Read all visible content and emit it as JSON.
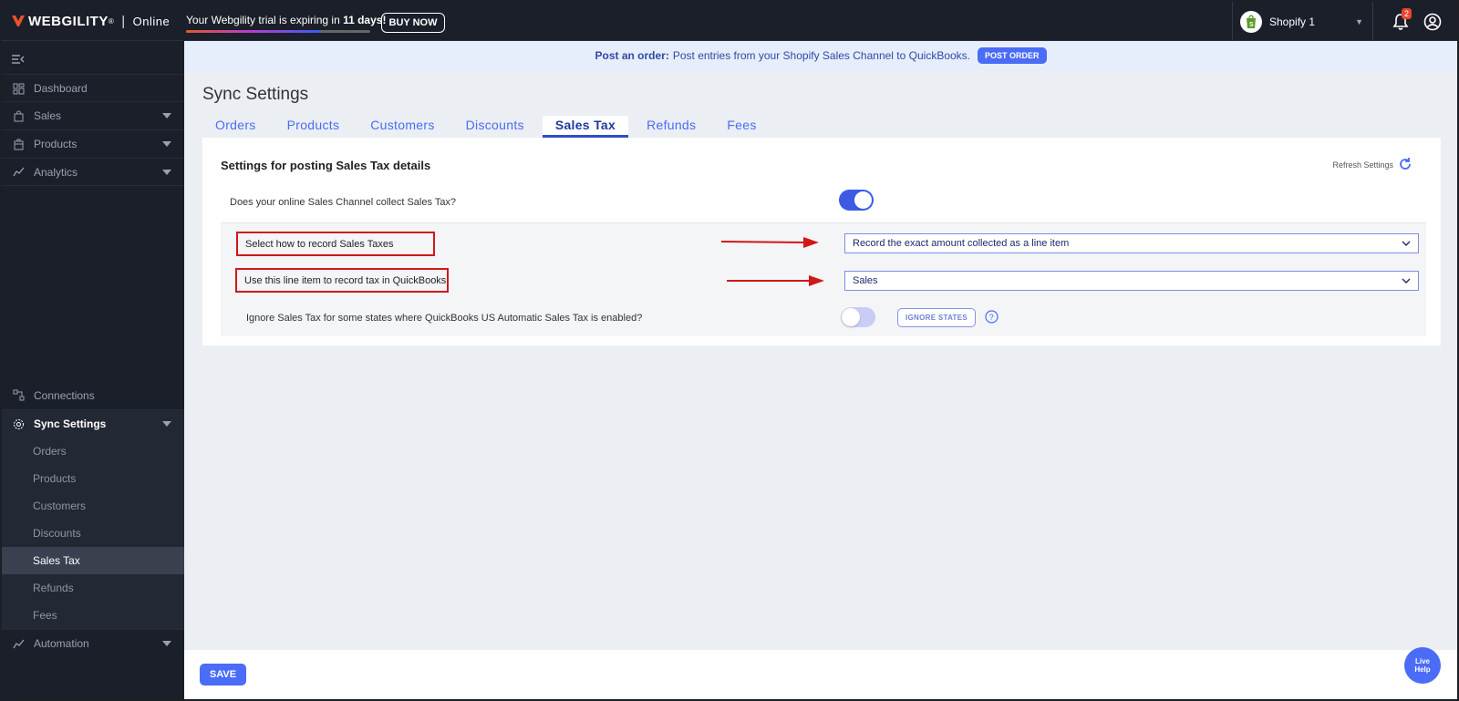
{
  "topbar": {
    "brand": "WEBGILITY",
    "brand_sup": "®",
    "separator": "|",
    "mode": "Online",
    "trial_prefix": "Your Webgility trial is expiring in ",
    "trial_days": "11 days!",
    "trial_progress": 0.73,
    "buy_now": "BUY NOW",
    "store_name": "Shopify 1",
    "notification_count": "2",
    "icons": {
      "bell": "bell-icon",
      "user": "user-circle-icon",
      "store": "shopify-icon"
    }
  },
  "sidebar": {
    "items": [
      {
        "label": "Dashboard",
        "icon": "dashboard-icon",
        "has_caret": false
      },
      {
        "label": "Sales",
        "icon": "bag-icon",
        "has_caret": true
      },
      {
        "label": "Products",
        "icon": "box-icon",
        "has_caret": true
      },
      {
        "label": "Analytics",
        "icon": "chart-icon",
        "has_caret": true
      }
    ],
    "connections": "Connections",
    "sync_settings": "Sync Settings",
    "sync_sub": [
      "Orders",
      "Products",
      "Customers",
      "Discounts",
      "Sales Tax",
      "Refunds",
      "Fees"
    ],
    "selected_sub": "Sales Tax",
    "automation": "Automation"
  },
  "banner": {
    "lead": "Post an order:",
    "text": "Post entries from your Shopify Sales Channel to QuickBooks.",
    "button": "POST ORDER"
  },
  "main": {
    "title": "Sync Settings",
    "tabs": [
      "Orders",
      "Products",
      "Customers",
      "Discounts",
      "Sales Tax",
      "Refunds",
      "Fees"
    ],
    "active_tab": "Sales Tax"
  },
  "panel": {
    "title": "Settings for posting Sales Tax details",
    "refresh": "Refresh Settings",
    "collect_question": "Does your online Sales Channel collect Sales Tax?",
    "collect_enabled": true,
    "record_label": "Select how to record Sales Taxes",
    "record_value": "Record the exact amount collected as a line item",
    "line_item_label": "Use this line item to record tax in QuickBooks",
    "line_item_value": "Sales",
    "ignore_question": "Ignore Sales Tax for some states where QuickBooks US Automatic Sales Tax is enabled?",
    "ignore_enabled": false,
    "ignore_button": "IGNORE STATES"
  },
  "footer": {
    "save": "SAVE"
  },
  "live_help": {
    "line1": "Live",
    "line2": "Help"
  },
  "colors": {
    "accent": "#4a6cf7",
    "highlight": "#d01818",
    "sidebar": "#1b1f2a"
  }
}
